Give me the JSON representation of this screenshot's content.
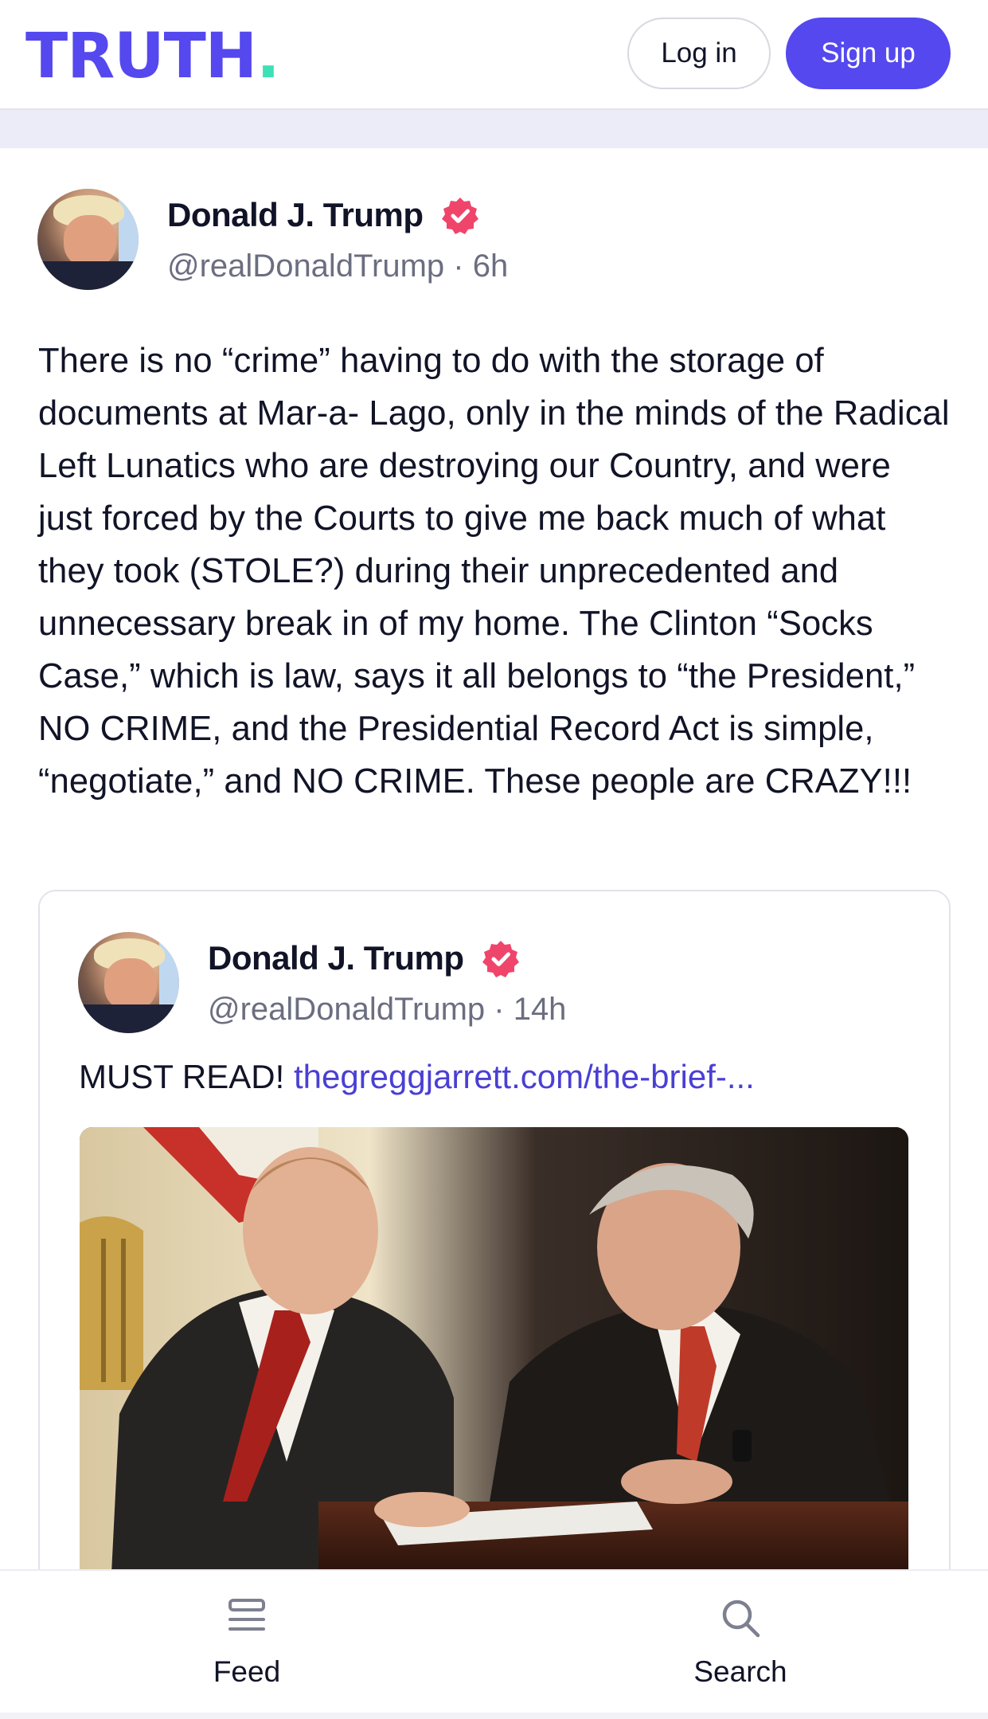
{
  "header": {
    "logo_text": "TRUTH",
    "logo_dot": ".",
    "login_label": "Log in",
    "signup_label": "Sign up",
    "brand_color": "#5448ee",
    "accent_color": "#3fe0b7"
  },
  "post": {
    "author_name": "Donald J. Trump",
    "handle": "@realDonaldTrump · 6h",
    "verified_icon": "verified-badge-icon",
    "text": "There is no “crime” having to do with the storage of documents at Mar-a- Lago, only in the minds of the Radical Left Lunatics who are destroying our Country, and were just forced by the Courts to give me back much of what they took (STOLE?) during their unprecedented and unnecessary break in of my home. The Clinton “Socks Case,” which is law, says it all belongs to “the President,” NO CRIME, and the Presidential Record Act is simple, “negotiate,” and NO CRIME. These people are CRAZY!!!"
  },
  "quoted_post": {
    "author_name": "Donald J. Trump",
    "handle": "@realDonaldTrump · 14h",
    "text_prefix": "MUST READ! ",
    "link_text": "thegreggjarrett.com/the-brief-...",
    "link_color": "#4a3fd4"
  },
  "bottom_nav": {
    "items": [
      {
        "label": "Feed",
        "icon": "feed-icon"
      },
      {
        "label": "Search",
        "icon": "search-icon"
      }
    ]
  },
  "colors": {
    "verified": "#f0456b",
    "text": "#111427",
    "muted": "#6b6e80"
  }
}
